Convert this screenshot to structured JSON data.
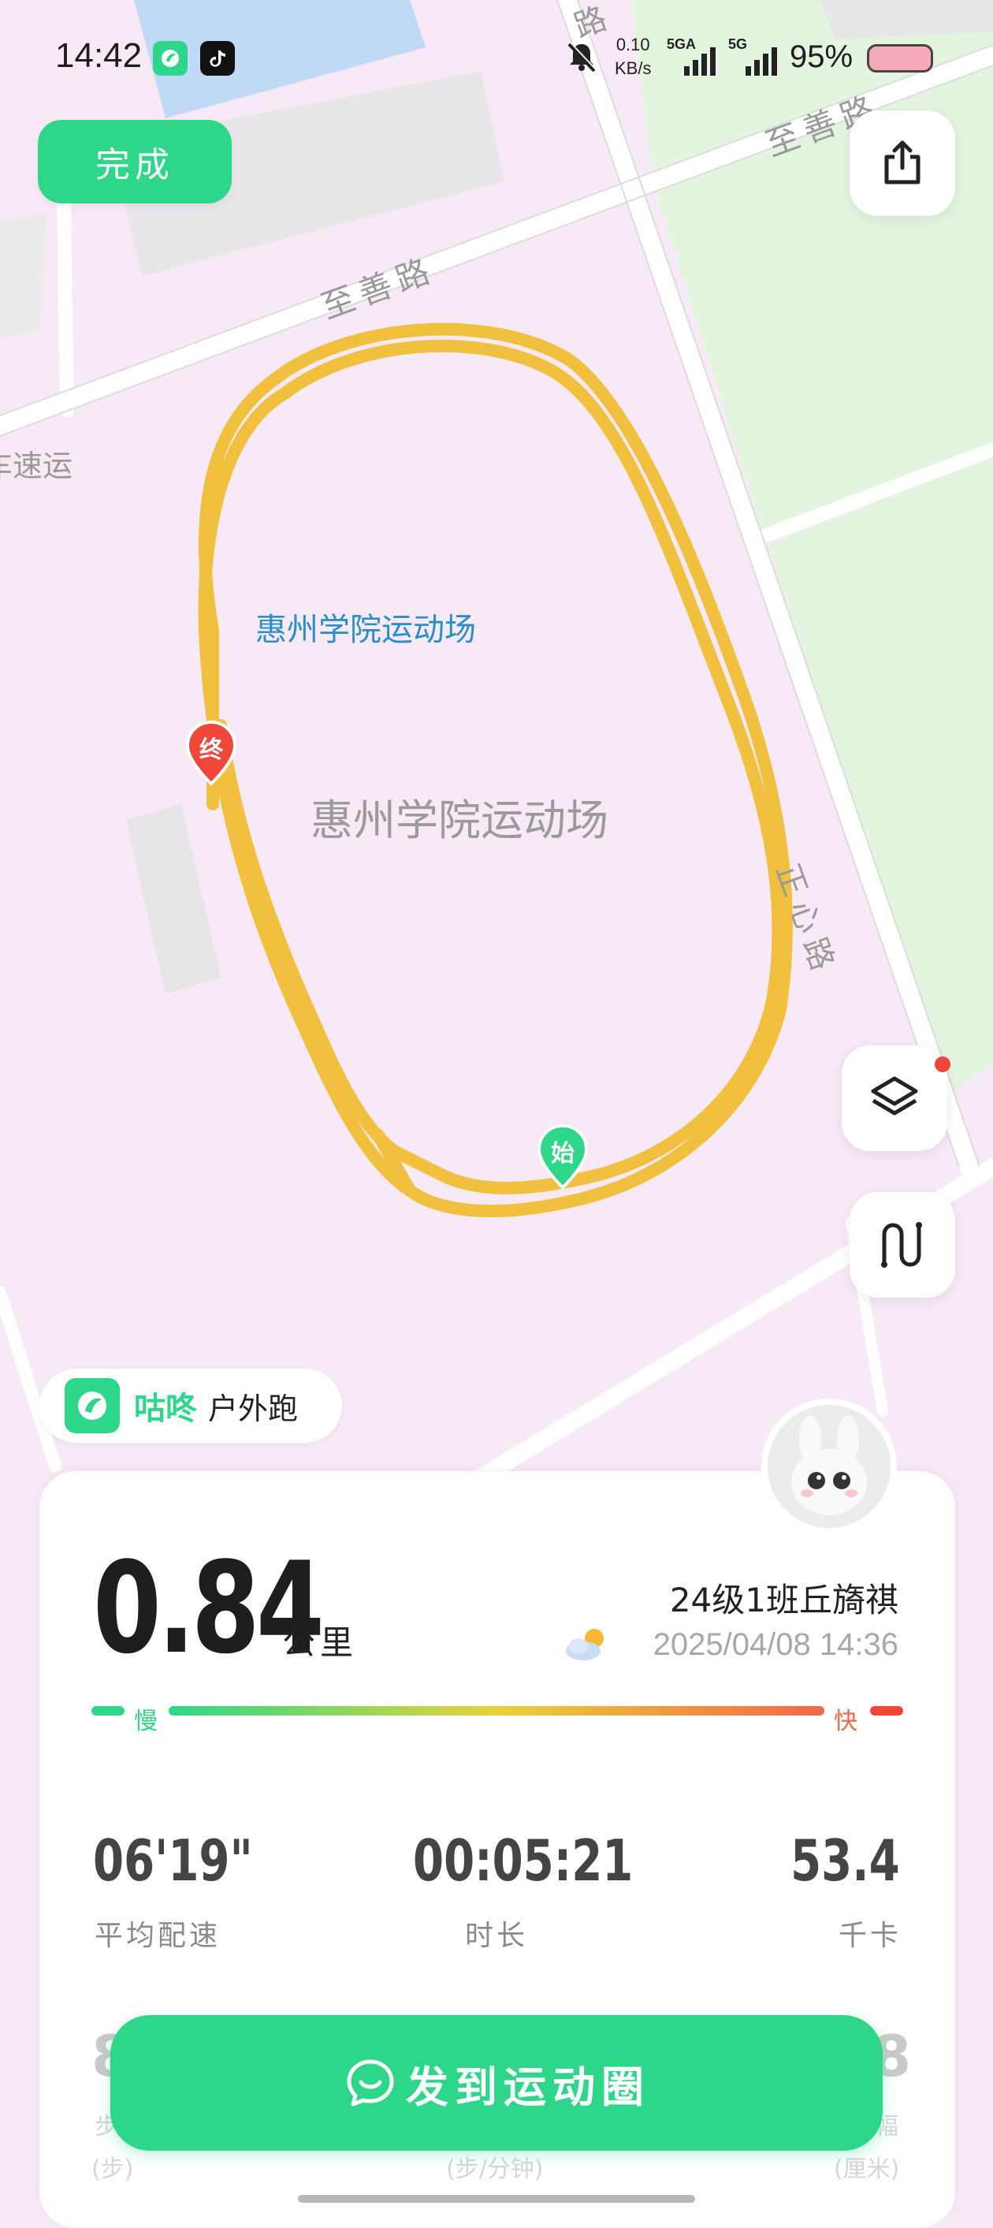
{
  "status_bar": {
    "time": "14:42",
    "net_speed_value": "0.10",
    "net_speed_unit": "KB/s",
    "signal1_label": "5GA",
    "signal2_label": "5G",
    "battery_percent": "95%"
  },
  "top_bar": {
    "done_label": "完成",
    "share_icon": "share-icon"
  },
  "map": {
    "road_labels": [
      "路",
      "至善路",
      "至善路",
      "正心路"
    ],
    "partial_label": "车速运",
    "venue_label_blue": "惠州学院运动场",
    "venue_label_gray": "惠州学院运动场",
    "start_marker": "始",
    "end_marker": "终",
    "route_color": "#f2c03f",
    "layers_icon": "layers-icon",
    "route_icon": "route-icon"
  },
  "brand": {
    "name": "咕咚",
    "sport": "户外跑"
  },
  "summary": {
    "distance": "0.84",
    "distance_unit": "公里",
    "user_name": "24级1班丘旖祺",
    "weather_icon": "partly-cloudy-icon",
    "datetime": "2025/04/08 14:36",
    "slow_label": "慢",
    "fast_label": "快",
    "stats": [
      {
        "value": "06'19\"",
        "label": "平均配速"
      },
      {
        "value": "00:05:21",
        "label": "时长"
      },
      {
        "value": "53.4",
        "label": "千卡"
      }
    ]
  },
  "peek_row": {
    "left_digit": "8",
    "left_label": "步",
    "left_sub": "(步)",
    "mid_sub": "(步/分钟)",
    "right_digit": "8",
    "right_label": "幅",
    "right_sub": "(厘米)"
  },
  "post_button": {
    "label": "发到运动圈"
  },
  "colors": {
    "accent": "#2ed68a",
    "end_marker": "#f0473a",
    "route": "#f2c03f"
  }
}
